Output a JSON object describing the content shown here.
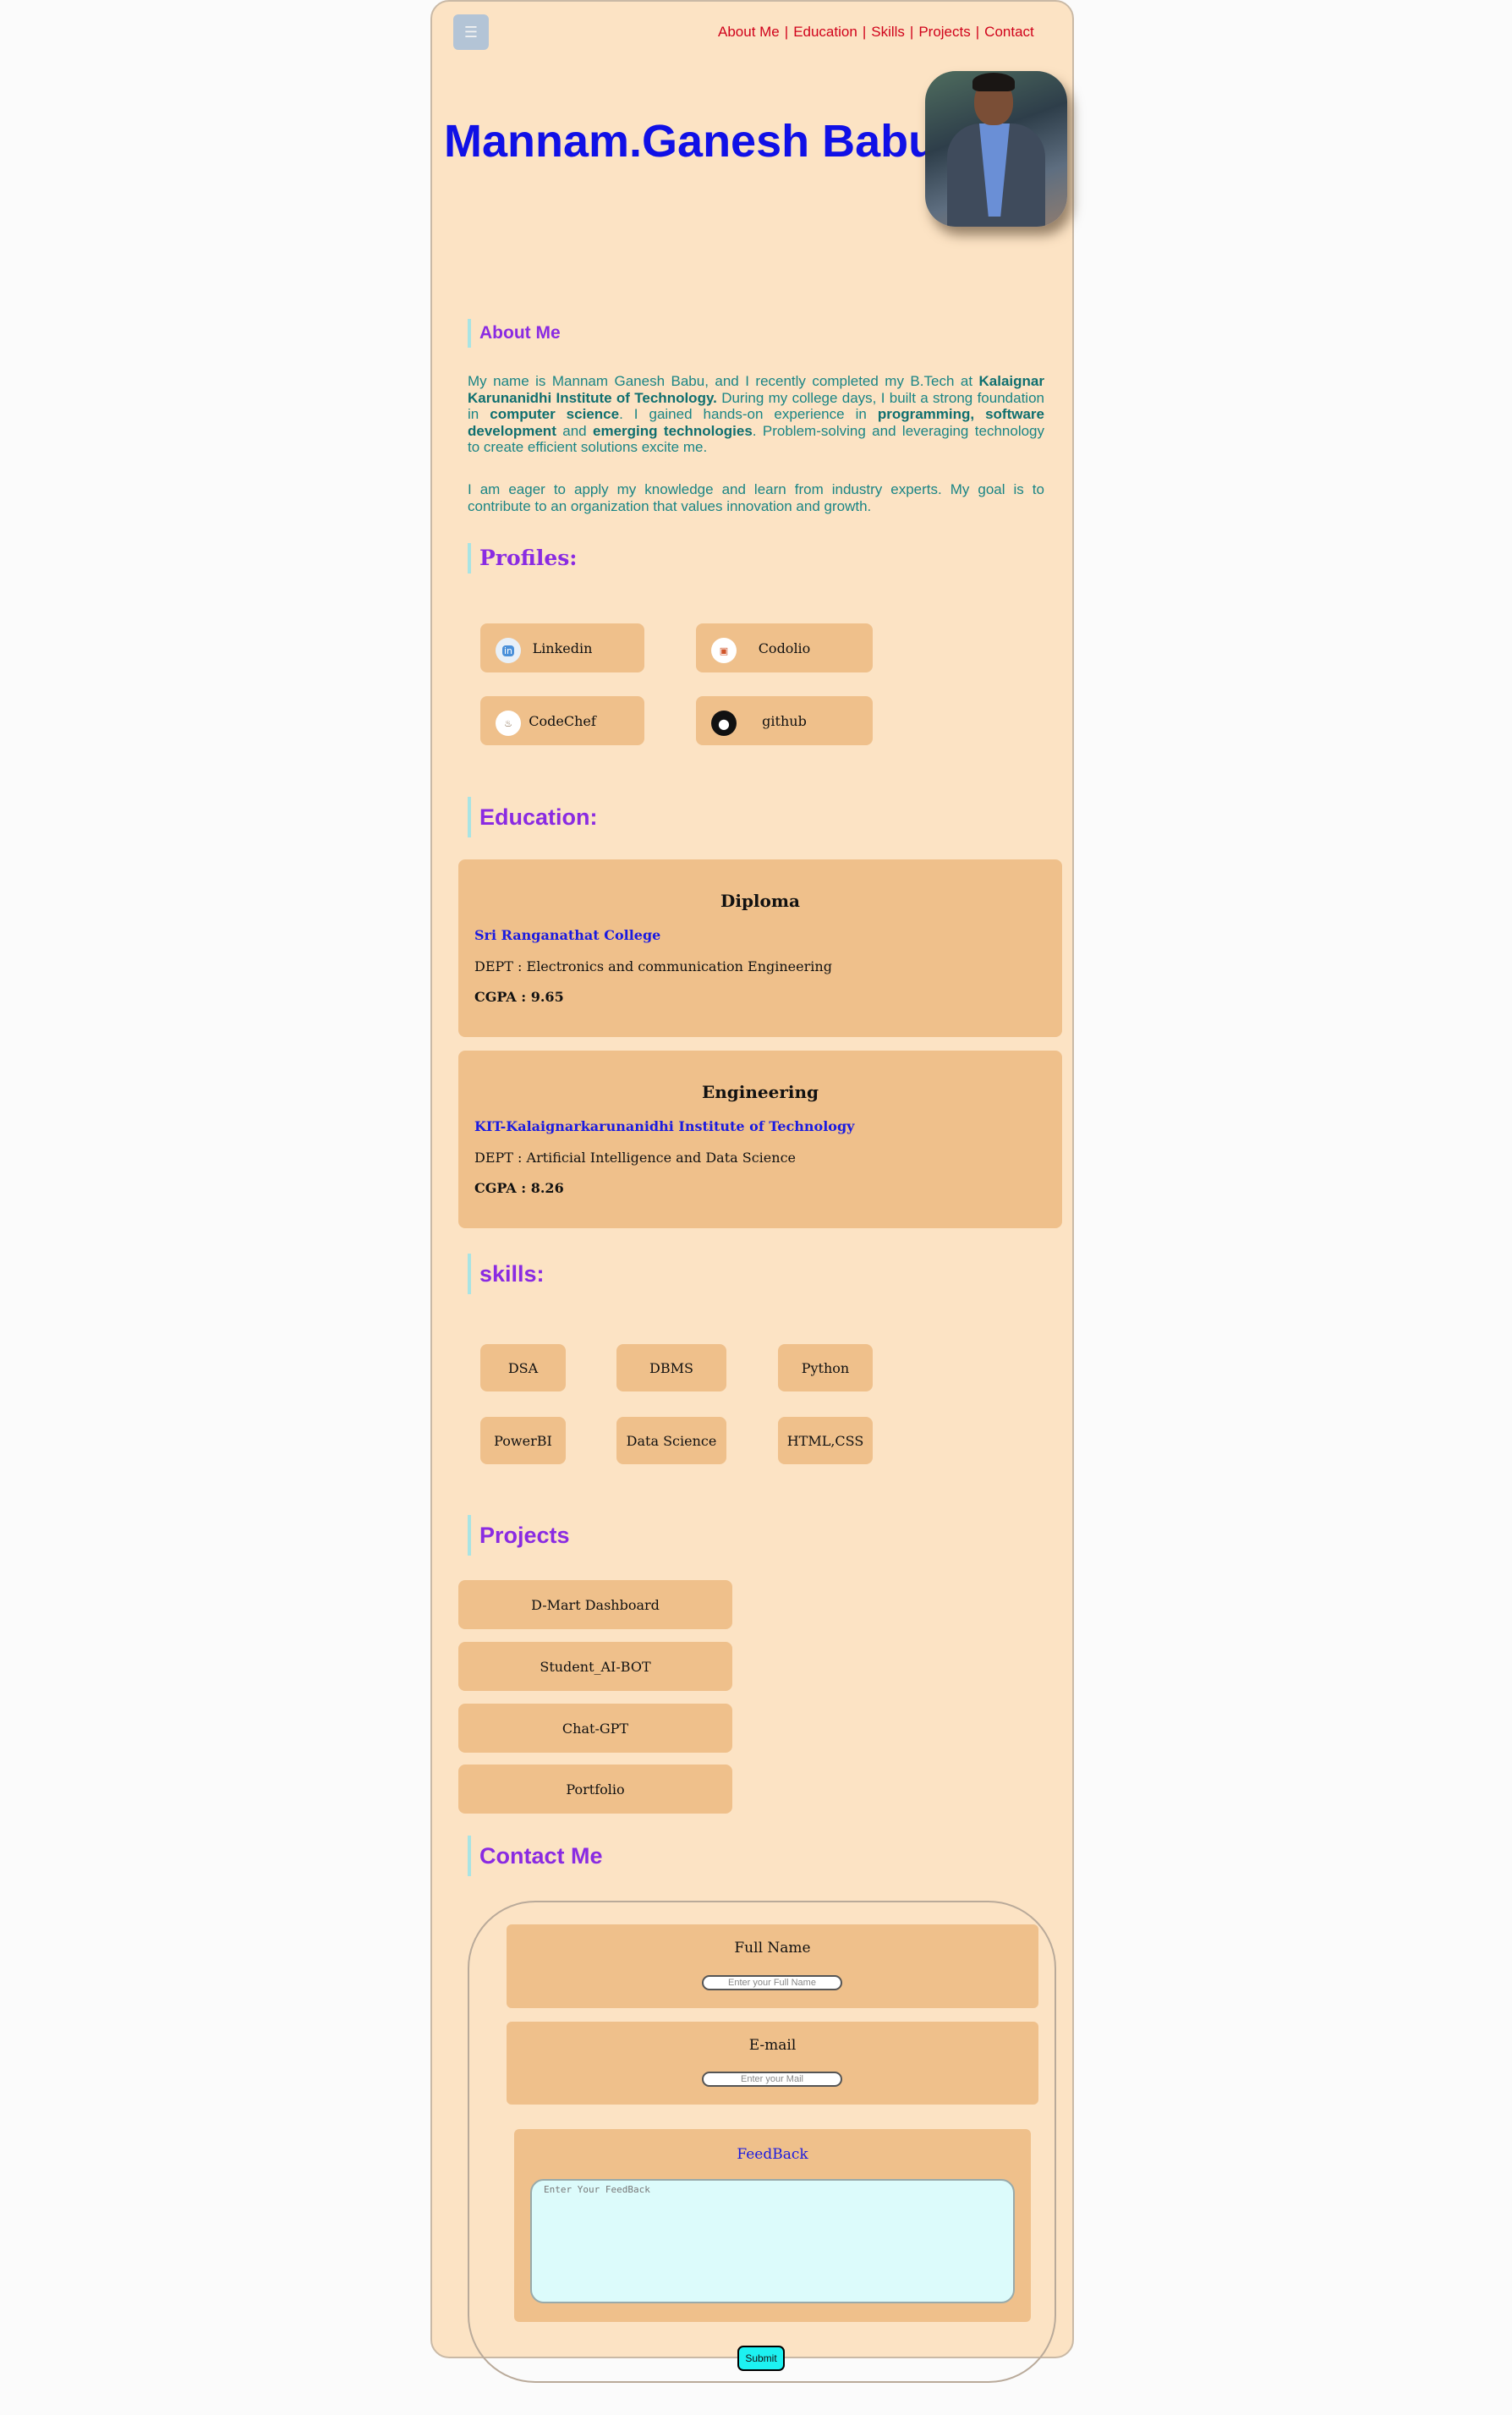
{
  "header": {
    "menu_icon": "☰",
    "nav": [
      "About Me",
      "Education",
      "Skills",
      "Projects",
      "Contact"
    ],
    "name": "Mannam.Ganesh Babu"
  },
  "about": {
    "heading": "About Me",
    "p1": [
      {
        "t": "My name is Mannam Ganesh Babu, and I recently completed my B.Tech at ",
        "b": false
      },
      {
        "t": "Kalaignar Karunanidhi Institute of Technology.",
        "b": true
      },
      {
        "t": " During my college days, I built a strong foundation in ",
        "b": false
      },
      {
        "t": "computer science",
        "b": true
      },
      {
        "t": ". I gained hands-on experience in ",
        "b": false
      },
      {
        "t": "programming, software development",
        "b": true
      },
      {
        "t": " and ",
        "b": false
      },
      {
        "t": "emerging technologies",
        "b": true
      },
      {
        "t": ". Problem-solving and leveraging technology to create efficient solutions excite me.",
        "b": false
      }
    ],
    "p2": "I am eager to apply my knowledge and learn from industry experts. My goal is to contribute to an organization that values innovation and growth."
  },
  "profiles": {
    "heading": "Profiles:",
    "items": [
      {
        "label": "Linkedin",
        "icon": "linkedin-icon",
        "glyph": "in"
      },
      {
        "label": "Codolio",
        "icon": "codolio-icon",
        "glyph": "▣"
      },
      {
        "label": "CodeChef",
        "icon": "codechef-icon",
        "glyph": "♨"
      },
      {
        "label": "github",
        "icon": "github-icon",
        "glyph": "●"
      }
    ]
  },
  "education": {
    "heading": "Education:",
    "items": [
      {
        "title": "Diploma",
        "college": "Sri Ranganathat College",
        "dept": "DEPT : Electronics and communication Engineering",
        "cgpa": "CGPA : 9.65"
      },
      {
        "title": "Engineering",
        "college": "KIT-Kalaignarkarunanidhi Institute of Technology",
        "dept": "DEPT : Artificial Intelligence and Data Science",
        "cgpa": "CGPA : 8.26"
      }
    ]
  },
  "skills": {
    "heading": "skills:",
    "items": [
      "DSA",
      "DBMS",
      "Python",
      "PowerBI",
      "Data Science",
      "HTML,CSS"
    ]
  },
  "projects": {
    "heading": "Projects",
    "items": [
      "D-Mart Dashboard",
      "Student_AI-BOT",
      "Chat-GPT",
      "Portfolio"
    ]
  },
  "contact": {
    "heading": "Contact Me",
    "name_label": "Full Name",
    "name_placeholder": "Enter your Full Name",
    "email_label": "E-mail",
    "email_placeholder": "Enter your Mail",
    "feedback_label": "FeedBack",
    "feedback_placeholder": "Enter Your FeedBack",
    "submit": "Submit"
  },
  "colors": {
    "page_bg": "#fce3c4",
    "card_bg": "#efc08b",
    "name": "#1010e6",
    "heading": "#8a2be2",
    "nav": "#d0021b",
    "about_text": "#1a8585",
    "submit": "#1df1f1"
  }
}
